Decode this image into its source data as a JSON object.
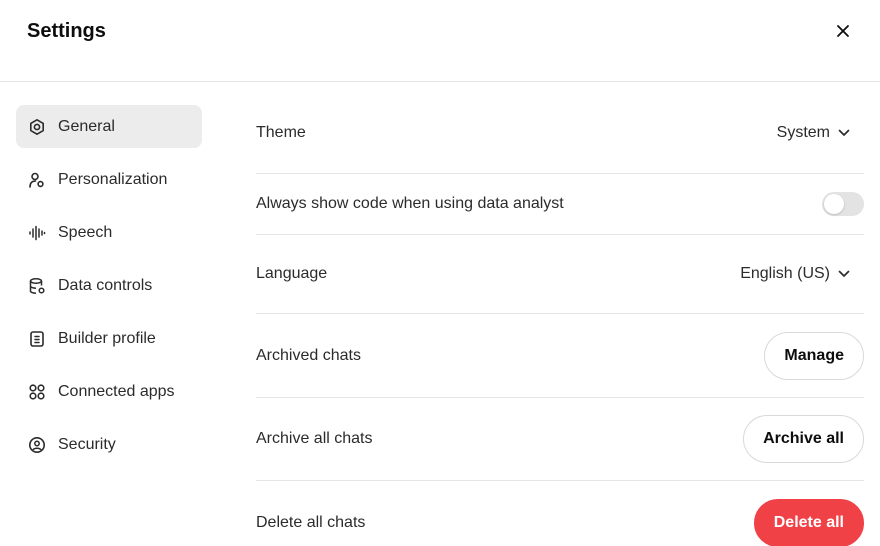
{
  "header": {
    "title": "Settings",
    "close_icon": "close-icon"
  },
  "sidebar": {
    "items": [
      {
        "label": "General",
        "icon": "gear-icon",
        "active": true
      },
      {
        "label": "Personalization",
        "icon": "person-icon",
        "active": false
      },
      {
        "label": "Speech",
        "icon": "waveform-icon",
        "active": false
      },
      {
        "label": "Data controls",
        "icon": "database-icon",
        "active": false
      },
      {
        "label": "Builder profile",
        "icon": "id-card-icon",
        "active": false
      },
      {
        "label": "Connected apps",
        "icon": "apps-grid-icon",
        "active": false
      },
      {
        "label": "Security",
        "icon": "shield-icon",
        "active": false
      }
    ]
  },
  "general": {
    "theme": {
      "label": "Theme",
      "value": "System"
    },
    "code_toggle": {
      "label": "Always show code when using data analyst",
      "enabled": false
    },
    "language": {
      "label": "Language",
      "value": "English (US)"
    },
    "archived_chats": {
      "label": "Archived chats",
      "button": "Manage"
    },
    "archive_all": {
      "label": "Archive all chats",
      "button": "Archive all"
    },
    "delete_all": {
      "label": "Delete all chats",
      "button": "Delete all"
    }
  },
  "colors": {
    "danger": "#ef4146",
    "active_nav_bg": "#ececec",
    "divider": "#e5e5e5",
    "toggle_off": "#e3e3e3"
  }
}
